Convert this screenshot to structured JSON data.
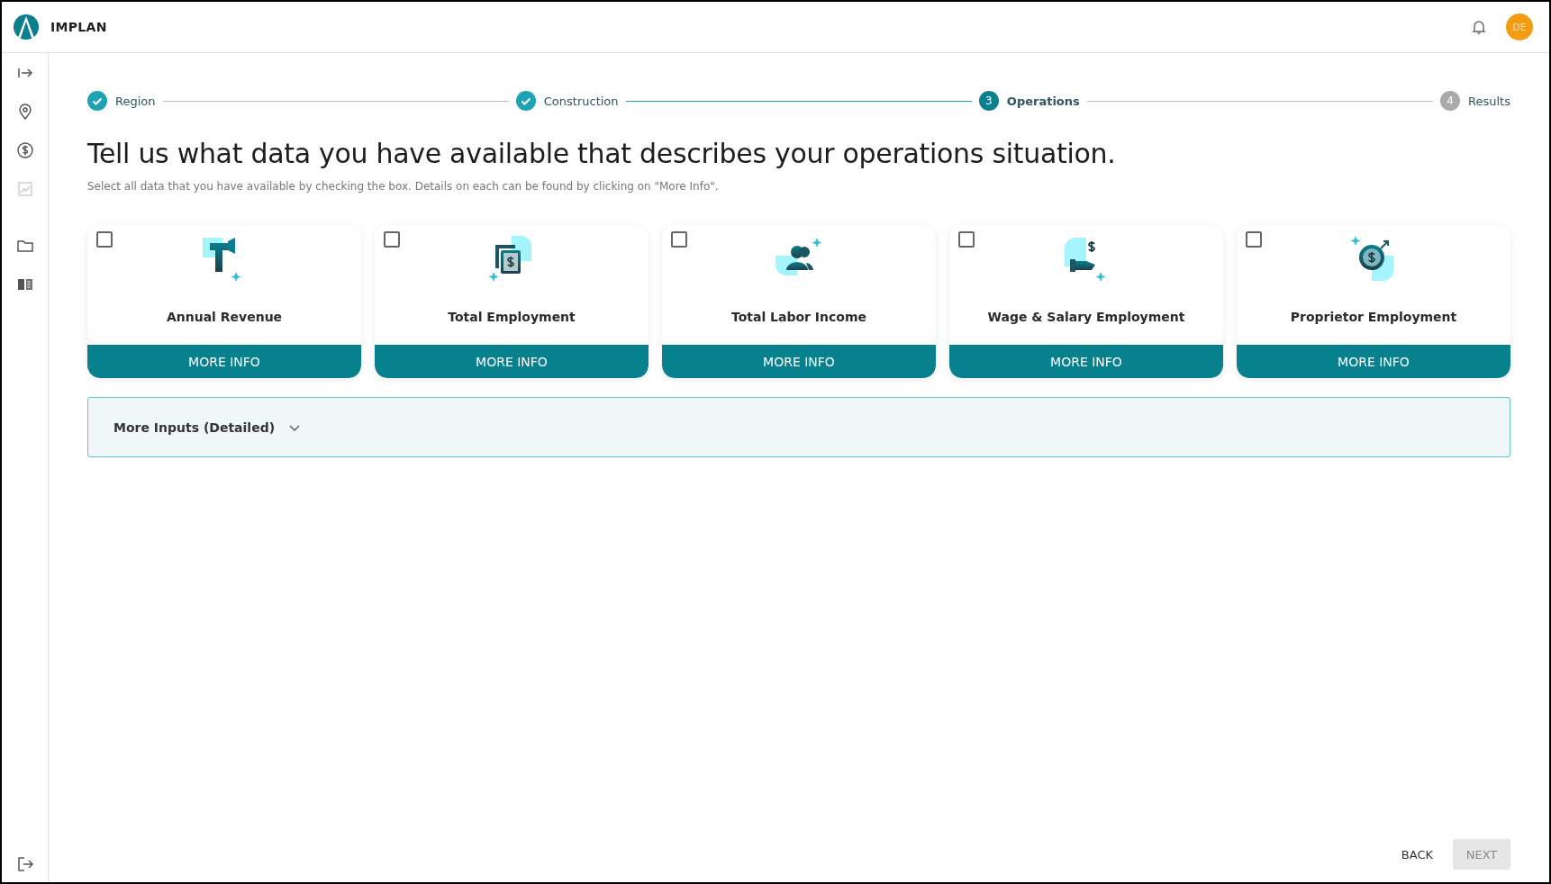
{
  "header": {
    "brand": "IMPLAN",
    "avatar": "DE"
  },
  "sidebar": {
    "items": [
      {
        "disabled": false
      },
      {
        "disabled": false
      },
      {
        "disabled": false
      },
      {
        "disabled": true
      },
      {
        "disabled": false
      },
      {
        "disabled": false
      }
    ]
  },
  "stepper": [
    {
      "label": "Region",
      "done": true,
      "selected": false
    },
    {
      "label": "Construction",
      "done": true,
      "selected": false
    },
    {
      "number": "3",
      "label": "Operations",
      "done": false,
      "selected": true
    },
    {
      "number": "4",
      "label": "Results",
      "done": false,
      "selected": false
    }
  ],
  "heading": "Tell us what data you have available that describes your operations situation.",
  "subtitle": "Select all data that you have available by checking the box. Details on each can be found by clicking on \"More Info\".",
  "cards": [
    {
      "title": "Annual Revenue",
      "checked": false,
      "button": "MORE INFO"
    },
    {
      "title": "Total Employment",
      "checked": false,
      "button": "MORE INFO"
    },
    {
      "title": "Total Labor Income",
      "checked": false,
      "button": "MORE INFO"
    },
    {
      "title": "Wage & Salary Employment",
      "checked": false,
      "button": "MORE INFO"
    },
    {
      "title": "Proprietor Employment",
      "checked": false,
      "button": "MORE INFO"
    }
  ],
  "accordion": {
    "label": "More Inputs (Detailed)",
    "expanded": false
  },
  "footer": {
    "back": {
      "label": "BACK",
      "disabled": false
    },
    "next": {
      "label": "NEXT",
      "disabled": true
    }
  }
}
